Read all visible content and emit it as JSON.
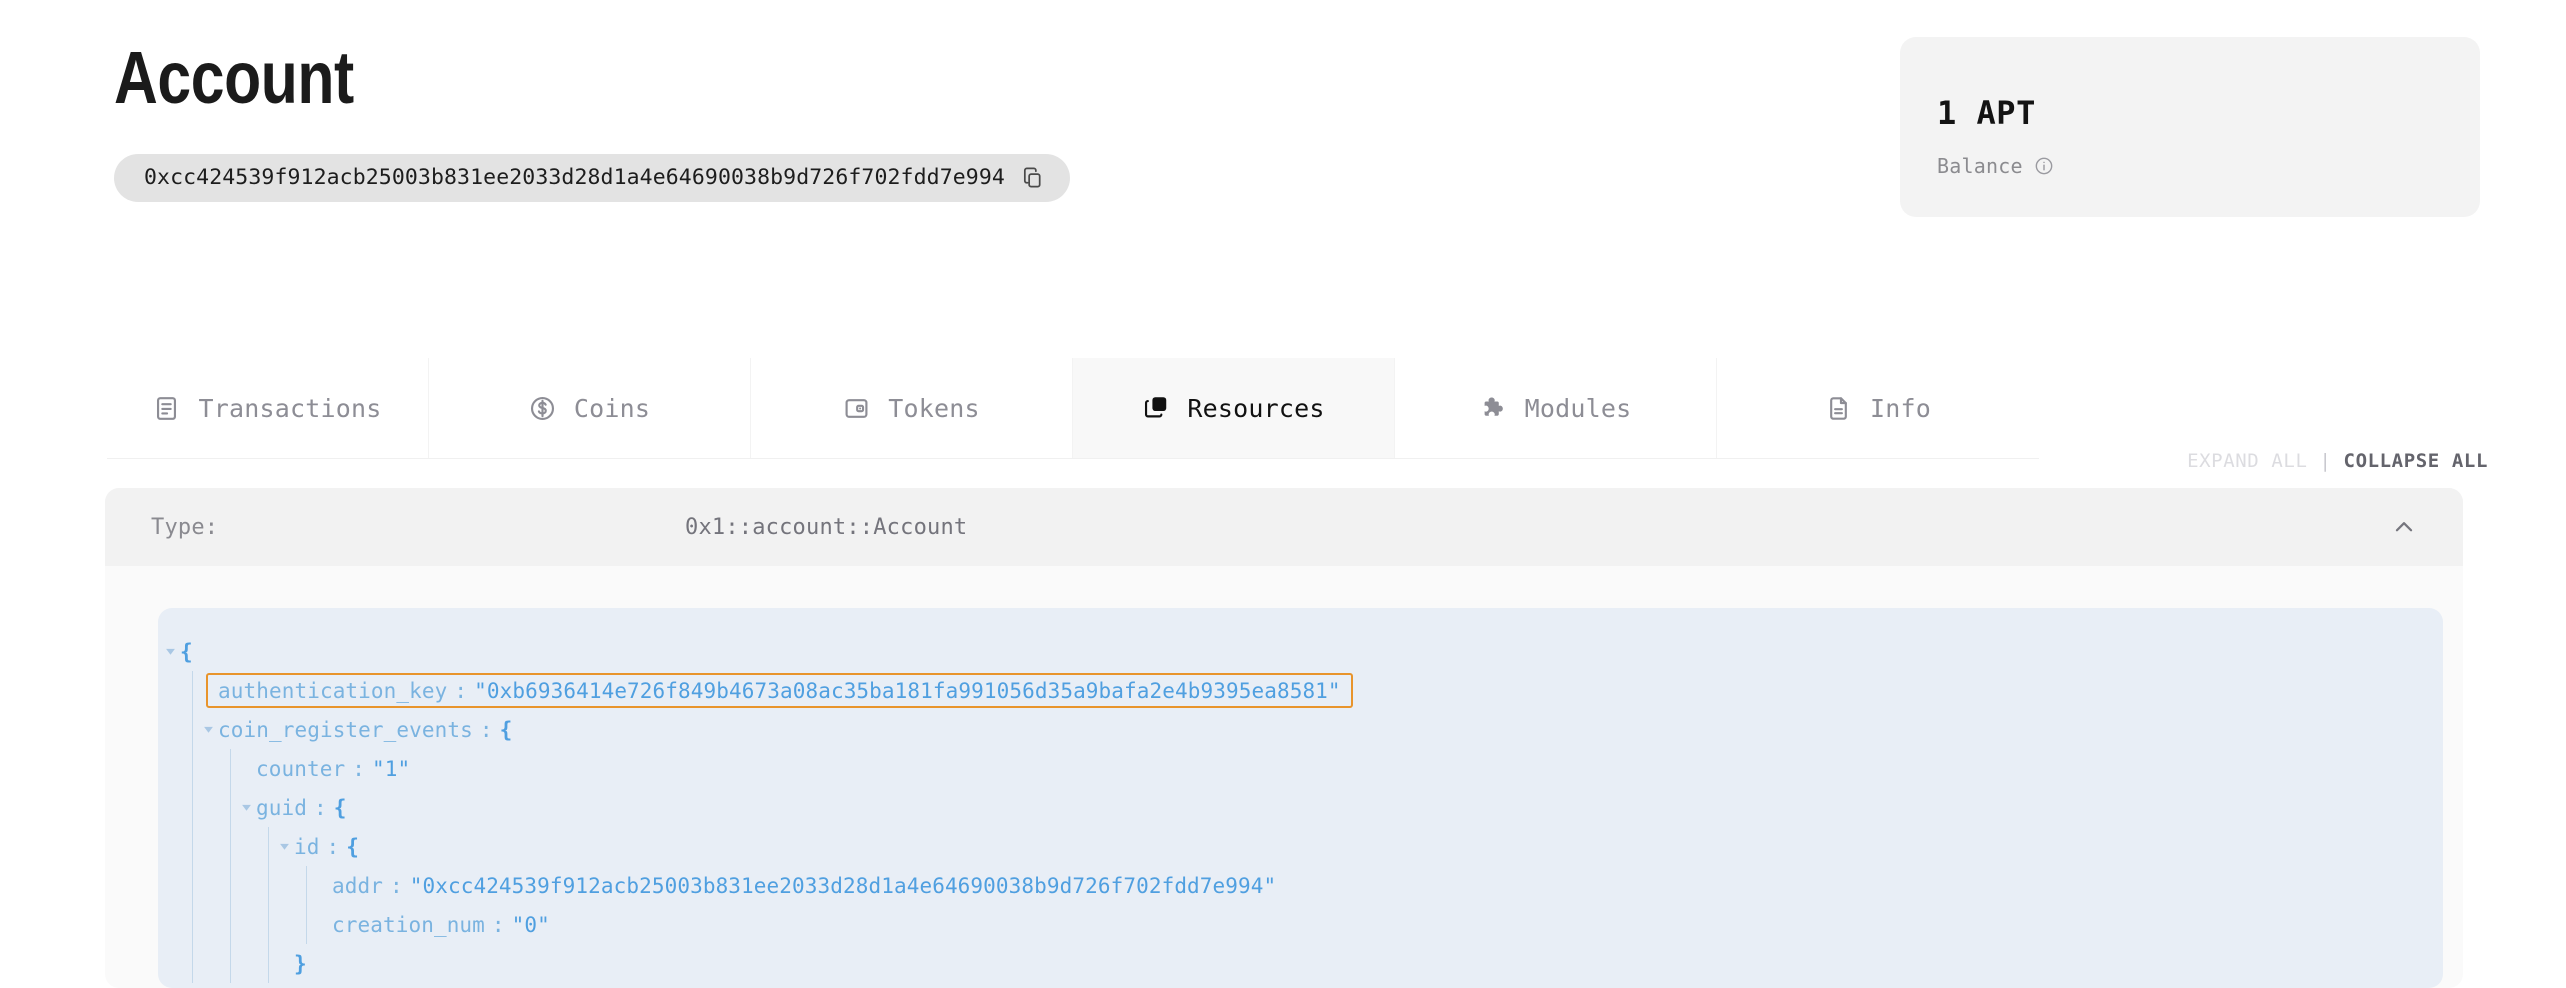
{
  "header": {
    "title": "Account",
    "address": "0xcc424539f912acb25003b831ee2033d28d1a4e64690038b9d726f702fdd7e994",
    "copy_icon": "copy-icon"
  },
  "balance_card": {
    "amount": "1 APT",
    "label": "Balance",
    "info_icon": "info-circle-icon"
  },
  "tabs": [
    {
      "label": "Transactions",
      "icon": "receipt-icon",
      "active": false
    },
    {
      "label": "Coins",
      "icon": "coin-dollar-icon",
      "active": false
    },
    {
      "label": "Tokens",
      "icon": "token-card-icon",
      "active": false
    },
    {
      "label": "Resources",
      "icon": "layers-icon",
      "active": true
    },
    {
      "label": "Modules",
      "icon": "puzzle-piece-icon",
      "active": false
    },
    {
      "label": "Info",
      "icon": "document-icon",
      "active": false
    }
  ],
  "tree_controls": {
    "expand_all": "EXPAND ALL",
    "separator": "|",
    "collapse_all": "COLLAPSE ALL"
  },
  "resource": {
    "type_label": "Type:",
    "type_value": "0x1::account::Account",
    "collapse_icon": "chevron-up-icon"
  },
  "json_tree": {
    "rows": [
      {
        "depth": 0,
        "toggle": "open",
        "brace": "{"
      },
      {
        "depth": 1,
        "key": "authentication_key",
        "value": "\"0xb6936414e726f849b4673a08ac35ba181fa991056d35a9bafa2e4b9395ea8581\"",
        "highlighted": true
      },
      {
        "depth": 1,
        "toggle": "open",
        "key": "coin_register_events",
        "brace": "{"
      },
      {
        "depth": 2,
        "key": "counter",
        "value": "\"1\""
      },
      {
        "depth": 2,
        "toggle": "open",
        "key": "guid",
        "brace": "{"
      },
      {
        "depth": 3,
        "toggle": "open",
        "key": "id",
        "brace": "{"
      },
      {
        "depth": 4,
        "key": "addr",
        "value": "\"0xcc424539f912acb25003b831ee2033d28d1a4e64690038b9d726f702fdd7e994\""
      },
      {
        "depth": 4,
        "key": "creation_num",
        "value": "\"0\""
      },
      {
        "depth": 3,
        "brace": "}"
      }
    ]
  },
  "colors": {
    "highlight_border": "#e8942c",
    "json_background": "#e8eef6",
    "json_text": "#4f9fe0",
    "panel_background": "#fafafa",
    "header_background": "#f2f2f2"
  }
}
